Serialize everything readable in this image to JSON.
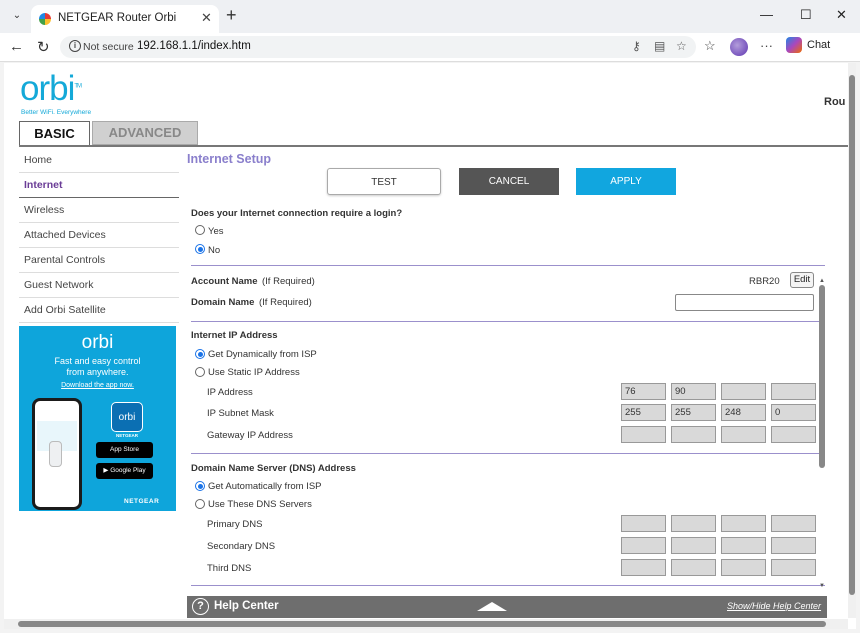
{
  "browser": {
    "tab_title": "NETGEAR Router Orbi",
    "tab_close": "✕",
    "new_tab": "+",
    "back": "←",
    "reload": "↻",
    "not_secure": "Not secure",
    "url": "192.168.1.1/index.htm",
    "more": "···",
    "chat_label": "Chat",
    "minimize": "—",
    "maximize": "☐",
    "close": "✕"
  },
  "header": {
    "logo": "orbi",
    "logo_tm": "TM",
    "tagline": "Better WiFi. Everywhere",
    "router_label_partial": "Rou"
  },
  "tabs": {
    "basic": "BASIC",
    "advanced": "ADVANCED"
  },
  "sidebar": {
    "items": [
      {
        "label": "Home"
      },
      {
        "label": "Internet"
      },
      {
        "label": "Wireless"
      },
      {
        "label": "Attached Devices"
      },
      {
        "label": "Parental Controls"
      },
      {
        "label": "Guest Network"
      },
      {
        "label": "Add Orbi Satellite"
      }
    ]
  },
  "promo": {
    "logo": "orbi",
    "line1": "Fast and easy control",
    "line2": "from anywhere.",
    "link": "Download the app now.",
    "app_icon": "orbi",
    "app_label": "NETGEAR",
    "app_store": "App Store",
    "google_play": "Google Play",
    "brand": "NETGEAR"
  },
  "page": {
    "title": "Internet Setup",
    "buttons": {
      "test": "TEST",
      "cancel": "CANCEL",
      "apply": "APPLY"
    },
    "login_question": "Does your Internet connection require a login?",
    "login_options": [
      "Yes",
      "No"
    ],
    "account_name_label": "Account Name",
    "account_name_hint": "(If Required)",
    "account_name_value": "RBR20",
    "edit": "Edit",
    "domain_name_label": "Domain Name",
    "domain_name_hint": "(If Required)",
    "domain_name_value": "",
    "ip_section": "Internet IP Address",
    "ip_options": [
      "Get Dynamically from ISP",
      "Use Static IP Address"
    ],
    "ip_address_label": "IP Address",
    "ip_address": [
      "76",
      "90",
      "",
      ""
    ],
    "subnet_label": "IP Subnet Mask",
    "subnet": [
      "255",
      "255",
      "248",
      "0"
    ],
    "gateway_label": "Gateway IP Address",
    "gateway": [
      "",
      "",
      "",
      ""
    ],
    "dns_section": "Domain Name Server (DNS) Address",
    "dns_options": [
      "Get Automatically from ISP",
      "Use These DNS Servers"
    ],
    "primary_dns_label": "Primary DNS",
    "primary_dns": [
      "",
      "",
      "",
      ""
    ],
    "secondary_dns_label": "Secondary DNS",
    "secondary_dns": [
      "",
      "",
      "",
      ""
    ],
    "third_dns_label": "Third DNS",
    "third_dns": [
      "",
      "",
      "",
      ""
    ]
  },
  "help": {
    "icon": "?",
    "title": "Help Center",
    "toggle": "Show/Hide Help Center"
  }
}
